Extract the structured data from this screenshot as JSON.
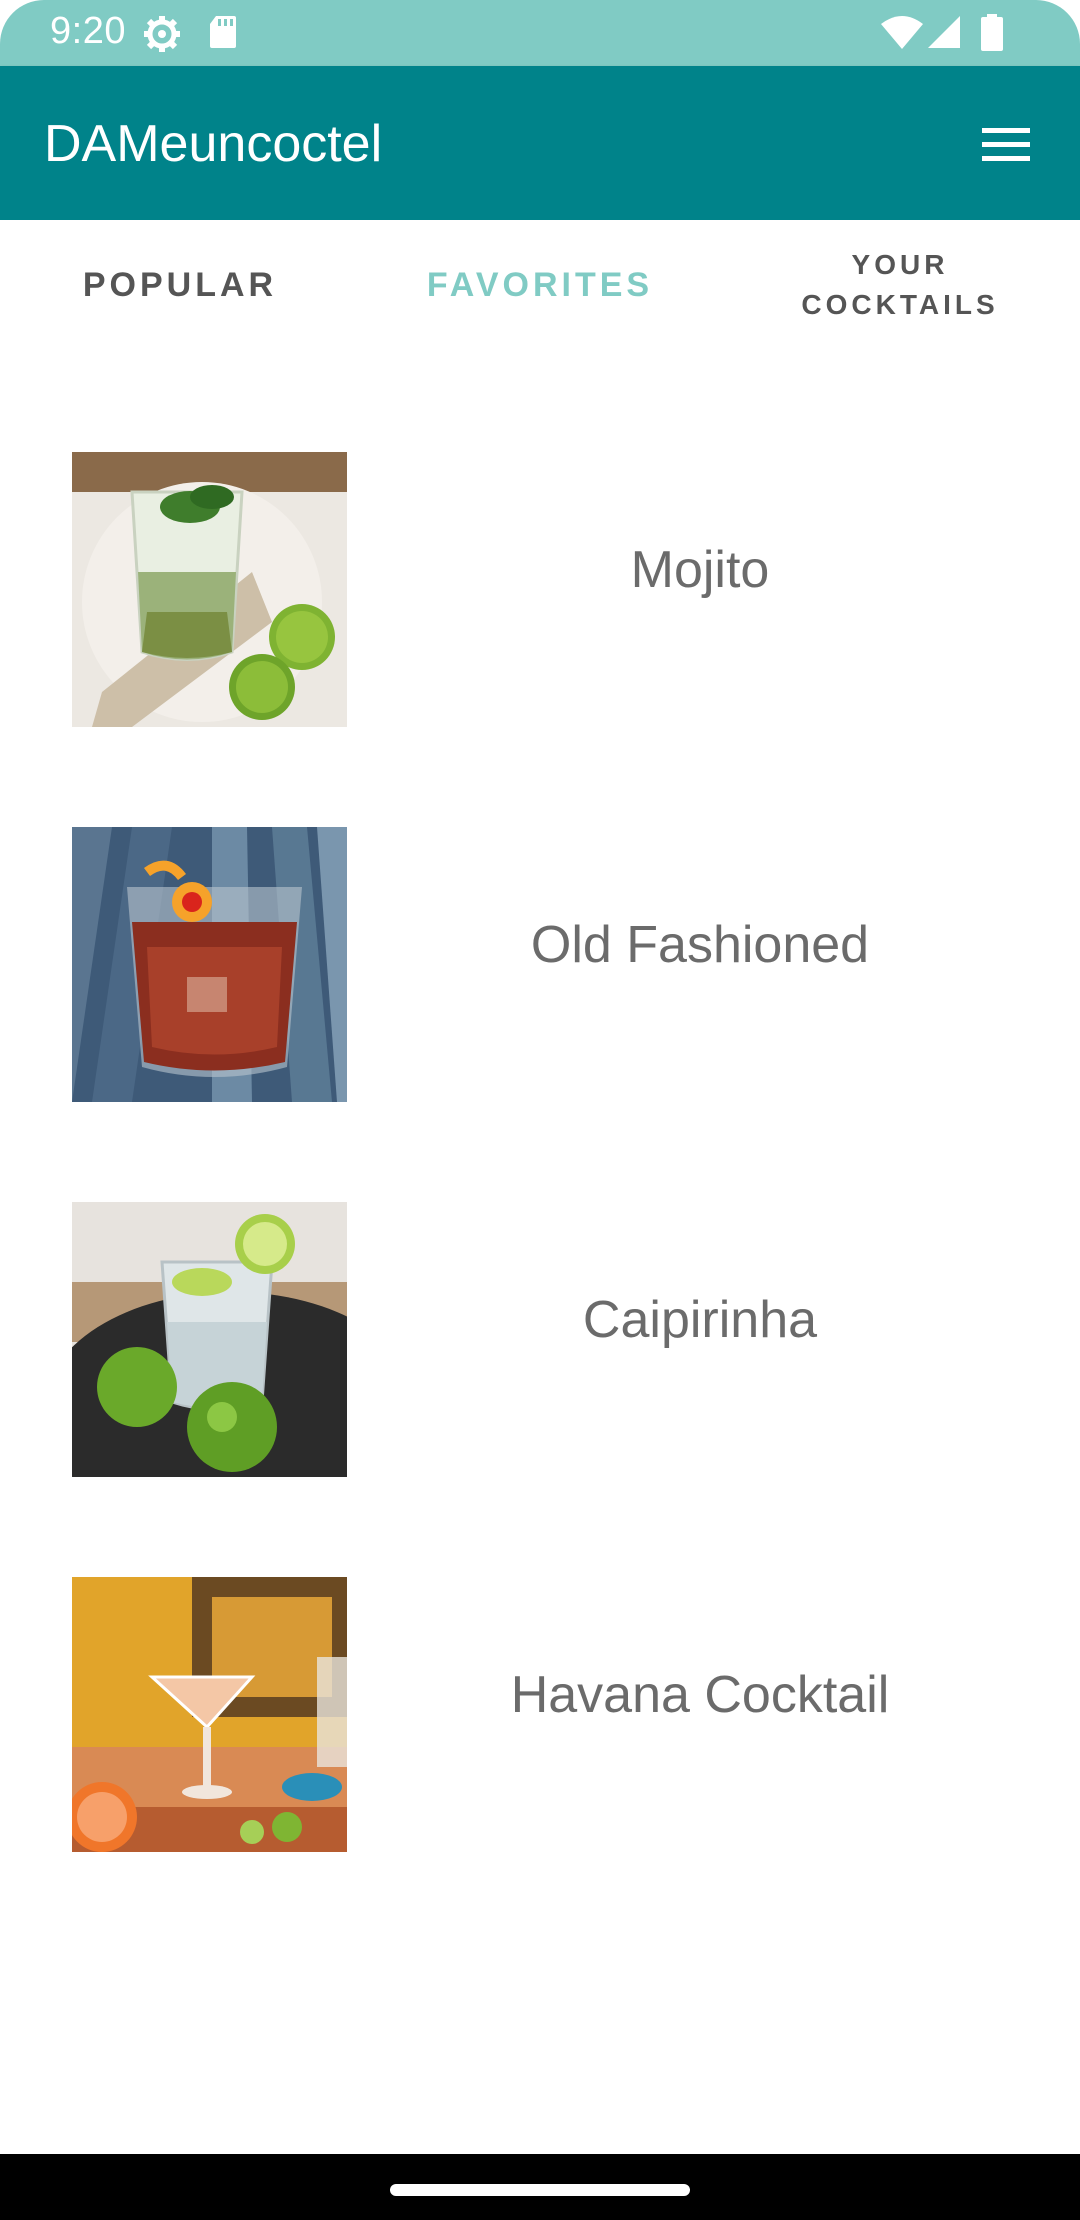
{
  "status_bar": {
    "time": "9:20",
    "icons": [
      "gear-icon",
      "sd-card-icon",
      "wifi-icon",
      "signal-icon",
      "battery-icon"
    ]
  },
  "app_bar": {
    "title": "DAMeuncoctel",
    "menu_icon": "hamburger-menu-icon",
    "background": "#00838a"
  },
  "tabs": [
    {
      "label": "POPULAR",
      "active": false
    },
    {
      "label": "FAVORITES",
      "active": true
    },
    {
      "label": "YOUR\nCOCKTAILS",
      "active": false
    }
  ],
  "accent_color": "#80cbc4",
  "cocktails": [
    {
      "name": "Mojito"
    },
    {
      "name": "Old Fashioned"
    },
    {
      "name": "Caipirinha"
    },
    {
      "name": "Havana Cocktail"
    }
  ]
}
